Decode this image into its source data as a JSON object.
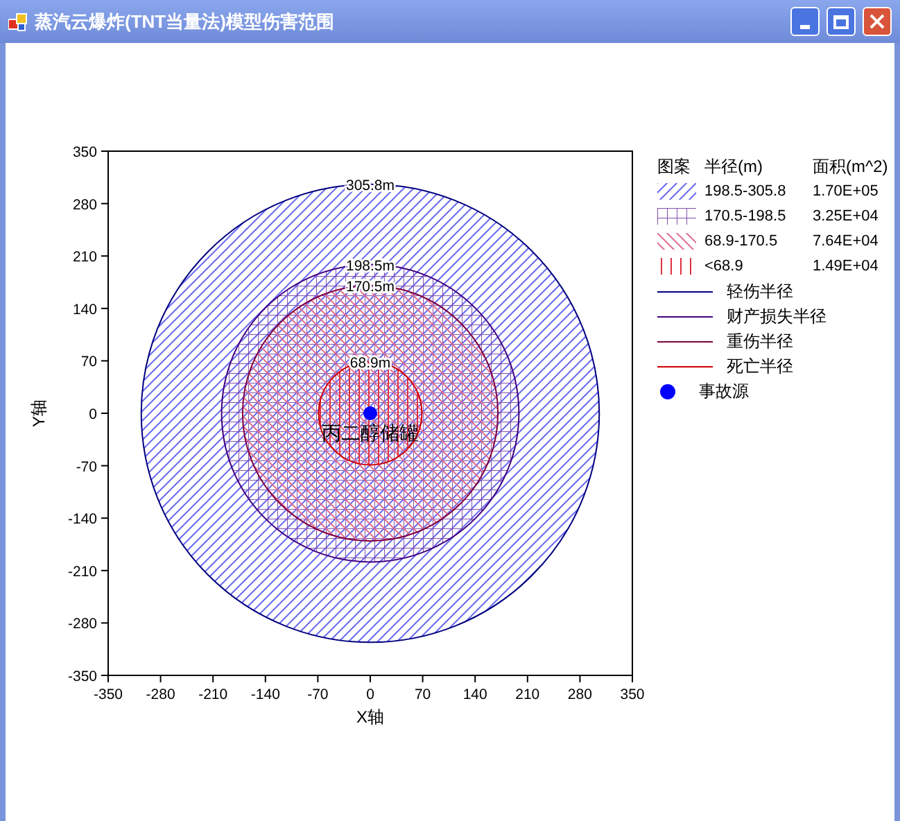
{
  "window": {
    "title": "蒸汽云爆炸(TNT当量法)模型伤害范围"
  },
  "plot": {
    "x_axis": {
      "label": "X轴",
      "ticks": [
        "-350",
        "-280",
        "-210",
        "-140",
        "-70",
        "0",
        "70",
        "140",
        "210",
        "280",
        "350"
      ]
    },
    "y_axis": {
      "label": "Y轴",
      "ticks": [
        "350",
        "280",
        "210",
        "140",
        "70",
        "0",
        "-70",
        "-140",
        "-210",
        "-280",
        "-350"
      ]
    },
    "zones": [
      {
        "kind": "diag-fwd",
        "label": "305.8m",
        "color": "#6a6af0"
      },
      {
        "kind": "grid",
        "label": "198.5m",
        "color": "#8050b0"
      },
      {
        "kind": "diag-back",
        "label": "170.5m",
        "color": "#e07090"
      },
      {
        "kind": "vertical",
        "label": "68.9m",
        "color": "#e03040"
      }
    ],
    "source": {
      "label": "丙二醇储罐",
      "color": "#0000ff"
    }
  },
  "legend": {
    "headers": [
      "图案",
      "半径(m)",
      "面积(m^2)"
    ],
    "items": [
      {
        "kind": "diag-fwd",
        "color": "#6a6af0",
        "range": "198.5-305.8",
        "area": "1.70E+05"
      },
      {
        "kind": "grid",
        "color": "#8050b0",
        "range": "170.5-198.5",
        "area": "3.25E+04"
      },
      {
        "kind": "diag-back",
        "color": "#e07090",
        "range": "68.9-170.5",
        "area": "7.64E+04"
      },
      {
        "kind": "vertical",
        "color": "#e03040",
        "range": "<68.9",
        "area": "1.49E+04"
      },
      {
        "kind": "line",
        "color": "#000080",
        "label": "轻伤半径"
      },
      {
        "kind": "line",
        "color": "#400080",
        "label": "财产损失半径"
      },
      {
        "kind": "line",
        "color": "#800040",
        "label": "重伤半径"
      },
      {
        "kind": "line",
        "color": "#d00000",
        "label": "死亡半径"
      },
      {
        "kind": "dot",
        "color": "#0000ff",
        "label": "事故源"
      }
    ]
  }
}
